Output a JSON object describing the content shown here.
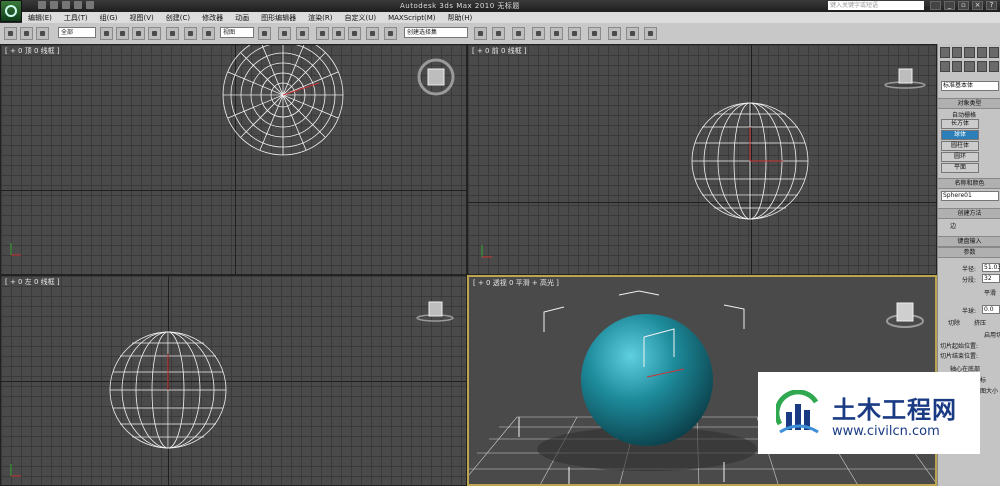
{
  "titlebar": {
    "title": "Autodesk 3ds Max   2010      无标题",
    "search_placeholder": "键入关键字或短语"
  },
  "menu": [
    "编辑(E)",
    "工具(T)",
    "组(G)",
    "视图(V)",
    "创建(C)",
    "修改器",
    "动画",
    "图形编辑器",
    "渲染(R)",
    "自定义(U)",
    "MAXScript(M)",
    "帮助(H)"
  ],
  "toolbar": {
    "selection_filter": "全部",
    "ref_coord": "视图",
    "named_selection": "创建选择集"
  },
  "viewports": {
    "top": {
      "label": "[ + 0 顶 0 线框 ]"
    },
    "front": {
      "label": "[ + 0 前 0 线框 ]"
    },
    "left": {
      "label": "[ + 0 左 0 线框 ]"
    },
    "persp": {
      "label": "[ + 0 透视 0 平滑 + 高光 ]"
    }
  },
  "cmdpanel": {
    "category": "标准基本体",
    "object_type": "对象类型",
    "autogrid": "自动栅格",
    "buttons": [
      "长方体",
      "球体",
      "圆柱体",
      "圆环",
      "平面"
    ],
    "name_color": "名称和颜色",
    "object_name": "Sphere01",
    "creation_method": "创建方法",
    "edge": "边",
    "keyboard_entry": "键盘输入",
    "parameters": "参数",
    "radius_label": "半径:",
    "radius_value": "51.038",
    "segments_label": "分段:",
    "segments_value": "32",
    "smooth": "平滑",
    "hemisphere_label": "半球:",
    "hemisphere_value": "0.0",
    "chop": "切除",
    "squash": "挤压",
    "slice_on": "启用切片",
    "slice_from": "切片起始位置:",
    "slice_to": "切片结束位置:",
    "base_to_pivot": "轴心在底部",
    "gen_mapping": "生成贴图坐标",
    "real_world": "真实世界贴图大小"
  },
  "watermark": {
    "name": "土木工程网",
    "url": "www.civilcn.com"
  },
  "colors": {
    "accent_persp_border": "#bba64f",
    "sphere": "#1d8a9a",
    "watermark_text": "#1a3b84"
  }
}
